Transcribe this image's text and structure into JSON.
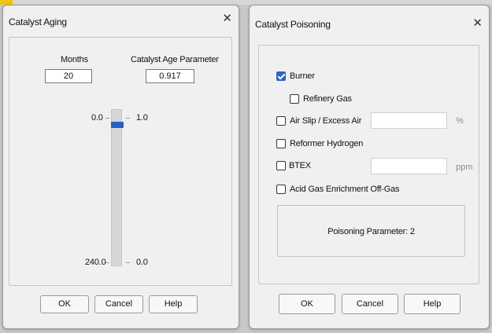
{
  "aging": {
    "title": "Catalyst Aging",
    "months_label": "Months",
    "months_value": "20",
    "param_label": "Catalyst Age Parameter",
    "param_value": "0.917",
    "slider": {
      "top_left": "0.0",
      "top_right": "1.0",
      "bottom_left": "240.0",
      "bottom_right": "0.0",
      "value_fraction": 0.083
    },
    "buttons": {
      "ok": "OK",
      "cancel": "Cancel",
      "help": "Help"
    }
  },
  "poisoning": {
    "title": "Catalyst Poisoning",
    "options": {
      "burner": {
        "label": "Burner",
        "checked": true
      },
      "refinery_gas": {
        "label": "Refinery Gas",
        "checked": false
      },
      "air_slip": {
        "label": "Air Slip / Excess Air",
        "checked": false,
        "value": "",
        "unit": "%"
      },
      "reformer_hydrogen": {
        "label": "Reformer Hydrogen",
        "checked": false
      },
      "btex": {
        "label": "BTEX",
        "checked": false,
        "value": "",
        "unit": "ppm"
      },
      "acid_gas": {
        "label": "Acid Gas Enrichment Off-Gas",
        "checked": false
      }
    },
    "parameter_text": "Poisoning Parameter: 2",
    "buttons": {
      "ok": "OK",
      "cancel": "Cancel",
      "help": "Help"
    }
  },
  "icons": {
    "close": "close-icon"
  },
  "colors": {
    "accent": "#2d63c4",
    "highlight": "#f2c40f"
  }
}
